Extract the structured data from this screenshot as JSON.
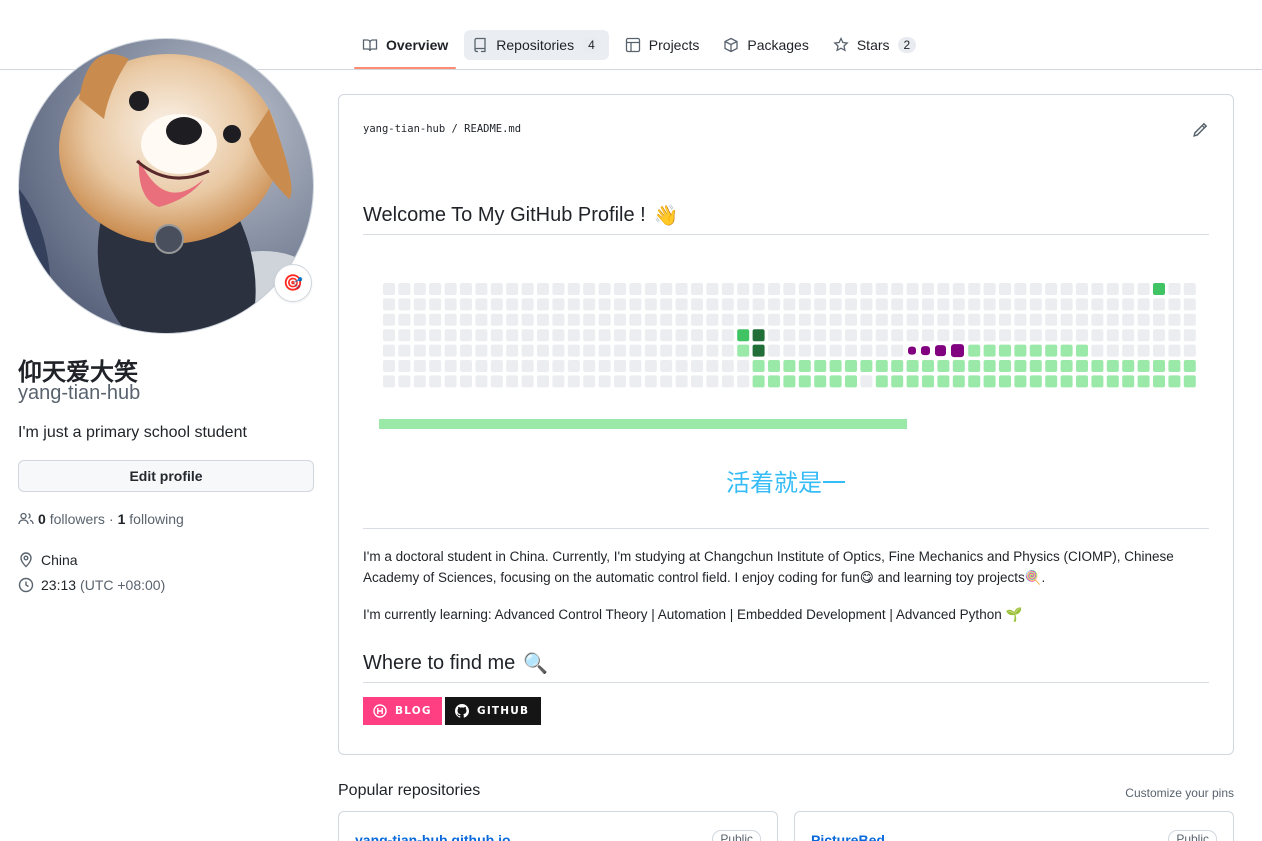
{
  "tabs": [
    {
      "label": "Overview",
      "icon": "book-icon",
      "selected": true
    },
    {
      "label": "Repositories",
      "icon": "repo-icon",
      "count": "4"
    },
    {
      "label": "Projects",
      "icon": "table-icon"
    },
    {
      "label": "Packages",
      "icon": "package-icon"
    },
    {
      "label": "Stars",
      "icon": "star-icon",
      "count": "2"
    }
  ],
  "profile": {
    "full_name": "仰天爱大笑",
    "username": "yang-tian-hub",
    "bio": "I'm just a primary school student",
    "edit_button": "Edit profile",
    "followers_count": "0",
    "followers_label": "followers",
    "separator": "·",
    "following_count": "1",
    "following_label": "following",
    "location": "China",
    "local_time": "23:13",
    "timezone": "(UTC +08:00)",
    "status_emoji": "🎯"
  },
  "readme": {
    "owner": "yang-tian-hub",
    "path_sep": "/",
    "file": "README.md",
    "heading": "Welcome To My GitHub Profile !",
    "heading_emoji": "👋",
    "typing_text": "活着就是一",
    "intro_text": "I'm a doctoral student in China. Currently, I'm studying at Changchun Institute of Optics, Fine Mechanics and Physics (CIOMP), Chinese Academy of Sciences, focusing on the automatic control field. I enjoy coding for fun",
    "intro_emoji_1": "😋",
    "intro_mid": " and learning toy projects",
    "intro_emoji_2": "🍭",
    "intro_end": ".",
    "learning_text": "I'm currently learning: Advanced Control Theory | Automation | Embedded Development | Advanced Python",
    "learning_emoji": "🌱",
    "find_heading": "Where to find me",
    "find_emoji": "🔍",
    "badges": [
      {
        "label": "BLOG",
        "color": "#ff3f81"
      },
      {
        "label": "GITHUB",
        "color": "#151515"
      }
    ]
  },
  "popular": {
    "title": "Popular repositories",
    "customize": "Customize your pins",
    "repos": [
      {
        "name": "yang-tian-hub.github.io",
        "visibility": "Public"
      },
      {
        "name": "PictureBed",
        "visibility": "Public"
      }
    ]
  },
  "colors": {
    "tab_underline": "#fd8c73",
    "link": "#0969da",
    "cell_empty": "#ebedf0",
    "cell_light": "#9be9a8",
    "cell_mid": "#40c463",
    "cell_dark": "#216e39",
    "snake": "#800080",
    "typing": "#36bcf7"
  }
}
